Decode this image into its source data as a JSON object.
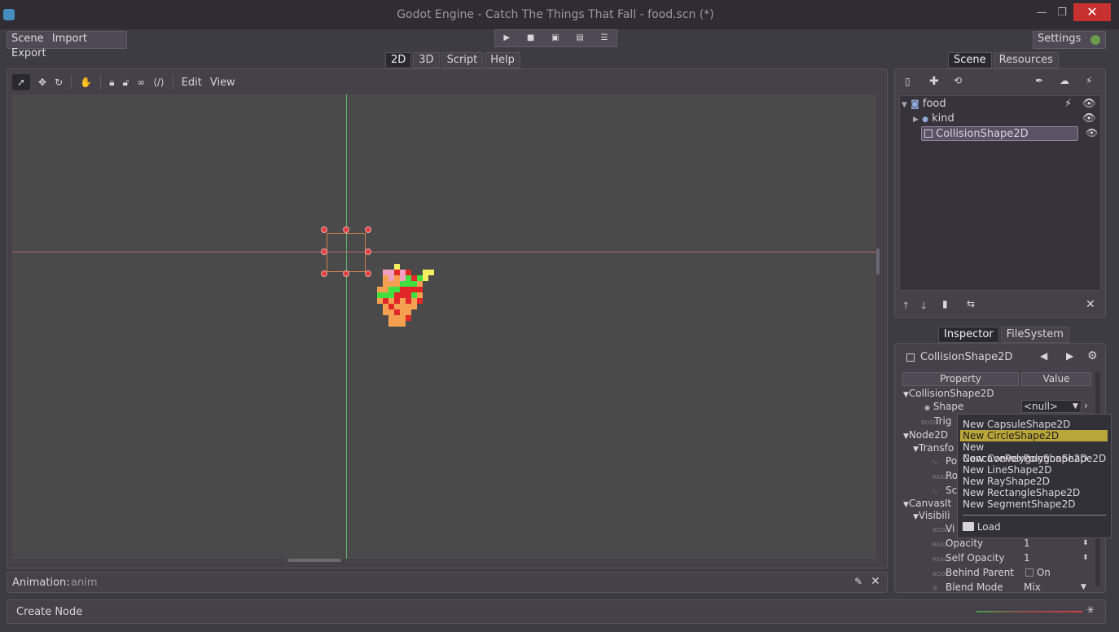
{
  "window": {
    "title": "Godot Engine - Catch The Things That Fall - food.scn (*)",
    "minimize": "—",
    "restore": "❐",
    "close": "✕"
  },
  "menu": {
    "scene": "Scene",
    "import": "Import",
    "export": "Export"
  },
  "play": {
    "play_icon": "play-icon",
    "stop_icon": "stop-icon",
    "scene_icon": "play-scene-icon",
    "custom_icon": "play-custom-icon",
    "debug_icon": "debug-options-icon"
  },
  "settings": {
    "label": "Settings"
  },
  "main_tabs": [
    {
      "label": "2D",
      "active": true
    },
    {
      "label": "3D"
    },
    {
      "label": "Script"
    },
    {
      "label": "Help"
    }
  ],
  "editor_toolbar": {
    "edit": "Edit",
    "view": "View"
  },
  "dock_top_tabs": [
    {
      "label": "Scene",
      "active": true
    },
    {
      "label": "Resources"
    }
  ],
  "scene_tree": [
    {
      "name": "food",
      "level": 0
    },
    {
      "name": "kind",
      "level": 1
    },
    {
      "name": "CollisionShape2D",
      "level": 1,
      "selected": true
    }
  ],
  "dock_bottom_tabs": [
    {
      "label": "Inspector",
      "active": true
    },
    {
      "label": "FileSystem"
    }
  ],
  "inspector": {
    "object": "CollisionShape2D",
    "col_property": "Property",
    "col_value": "Value",
    "section_collision": "CollisionShape2D",
    "shape_label": "Shape",
    "shape_value": "<null>",
    "trigger_label": "Trig",
    "section_node2d": "Node2D",
    "transform_label": "Transfo",
    "pos_label": "Po",
    "rot_label": "Ro",
    "scale_label": "Sc",
    "section_canvas": "CanvasIt",
    "visibility_label": "Visibili",
    "visible_label": "Vi",
    "opacity_label": "Opacity",
    "opacity_value": "1",
    "self_opacity_label": "Self Opacity",
    "self_opacity_value": "1",
    "behind_parent_label": "Behind Parent",
    "behind_parent_value": "On",
    "blend_label": "Blend Mode",
    "blend_value": "Mix"
  },
  "shape_menu": {
    "items": [
      "New CapsuleShape2D",
      "New CircleShape2D",
      "New ConcavePolygonShape2D",
      "New ConvexPolygonShape2D",
      "New LineShape2D",
      "New RayShape2D",
      "New RectangleShape2D",
      "New SegmentShape2D"
    ],
    "highlighted": "New CircleShape2D",
    "load": "Load"
  },
  "animation": {
    "label": "Animation:",
    "name": "anim"
  },
  "status": {
    "text": "Create Node"
  },
  "colors": {
    "accent": "#b9a63a",
    "selection_handle": "#e04040",
    "axis_x": "#c86464",
    "axis_y": "#64c864"
  }
}
